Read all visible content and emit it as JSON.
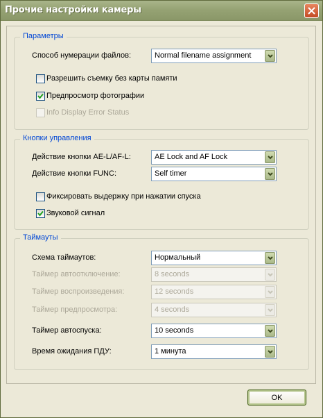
{
  "window": {
    "title": "Прочие настройки камеры"
  },
  "params": {
    "title": "Параметры",
    "numbering_label": "Способ нумерации файлов:",
    "numbering_value": "Normal filename assignment",
    "allow_no_card": {
      "label": "Разрешить съемку без карты памяти",
      "checked": false
    },
    "preview_photo": {
      "label": "Предпросмотр фотографии",
      "checked": true
    },
    "info_display": {
      "label": "Info Display Error Status",
      "checked": false,
      "disabled": true
    }
  },
  "controls": {
    "title": "Кнопки управления",
    "ael_label": "Действие кнопки AE-L/AF-L:",
    "ael_value": "AE Lock and AF Lock",
    "func_label": "Действие кнопки FUNC:",
    "func_value": "Self timer",
    "fix_exposure": {
      "label": "Фиксировать выдержку при нажатии спуска",
      "checked": false
    },
    "beep": {
      "label": "Звуковой сигнал",
      "checked": true
    }
  },
  "timeouts": {
    "title": "Таймауты",
    "scheme_label": "Схема таймаутов:",
    "scheme_value": "Нормальный",
    "auto_off_label": "Таймер автоотключение:",
    "auto_off_value": "8 seconds",
    "playback_label": "Таймер воспроизведения:",
    "playback_value": "12 seconds",
    "preview_label": "Таймер предпросмотра:",
    "preview_value": "4 seconds",
    "self_timer_label": "Таймер автоспуска:",
    "self_timer_value": "10 seconds",
    "remote_label": "Время ожидания ПДУ:",
    "remote_value": "1 минута"
  },
  "buttons": {
    "ok": "OK"
  },
  "colors": {
    "group_title": "#0046d5",
    "window_bg": "#ece9d8",
    "titlebar": "#96a374"
  }
}
